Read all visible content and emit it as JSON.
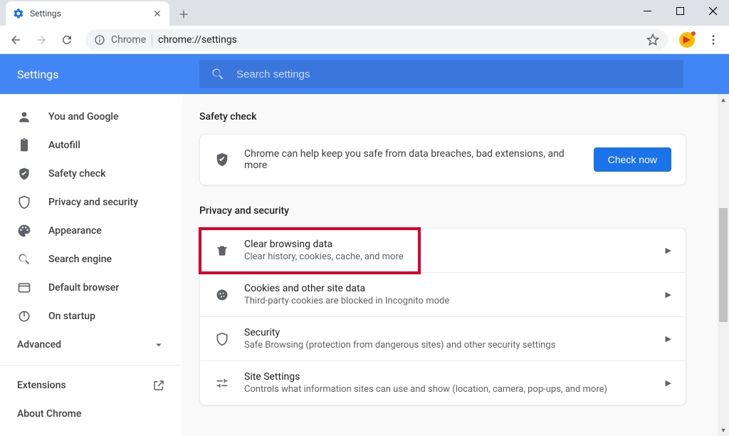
{
  "window": {
    "tab_title": "Settings",
    "url_host": "Chrome",
    "url_path": "chrome://settings"
  },
  "topbar": {
    "title": "Settings",
    "search_placeholder": "Search settings"
  },
  "sidebar": {
    "items": [
      {
        "label": "You and Google",
        "icon": "person-icon"
      },
      {
        "label": "Autofill",
        "icon": "clipboard-icon"
      },
      {
        "label": "Safety check",
        "icon": "shield-check-icon"
      },
      {
        "label": "Privacy and security",
        "icon": "shield-icon"
      },
      {
        "label": "Appearance",
        "icon": "palette-icon"
      },
      {
        "label": "Search engine",
        "icon": "search-icon"
      },
      {
        "label": "Default browser",
        "icon": "browser-icon"
      },
      {
        "label": "On startup",
        "icon": "power-icon"
      }
    ],
    "advanced_label": "Advanced",
    "footer": [
      {
        "label": "Extensions",
        "external": true
      },
      {
        "label": "About Chrome",
        "external": false
      }
    ]
  },
  "safety": {
    "section_title": "Safety check",
    "text": "Chrome can help keep you safe from data breaches, bad extensions, and more",
    "button": "Check now"
  },
  "privacy": {
    "section_title": "Privacy and security",
    "rows": [
      {
        "title": "Clear browsing data",
        "desc": "Clear history, cookies, cache, and more",
        "icon": "trash-icon",
        "highlighted": true
      },
      {
        "title": "Cookies and other site data",
        "desc": "Third-party cookies are blocked in Incognito mode",
        "icon": "cookie-icon"
      },
      {
        "title": "Security",
        "desc": "Safe Browsing (protection from dangerous sites) and other security settings",
        "icon": "shield-icon"
      },
      {
        "title": "Site Settings",
        "desc": "Controls what information sites can use and show (location, camera, pop-ups, and more)",
        "icon": "tune-icon"
      }
    ]
  }
}
